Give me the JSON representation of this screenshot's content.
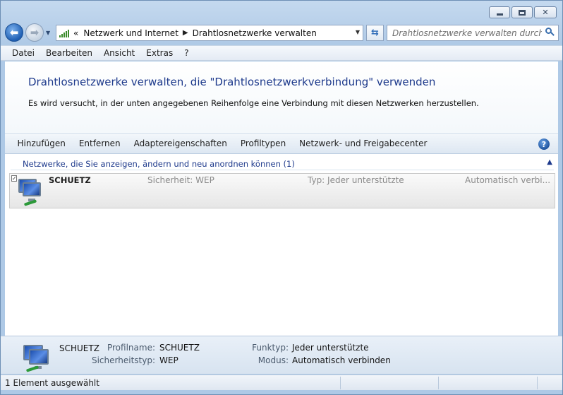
{
  "window": {
    "caption_buttons": [
      "minimize",
      "maximize",
      "close"
    ]
  },
  "nav": {
    "address_prefix": "«",
    "breadcrumbs": [
      "Netzwerk und Internet",
      "Drahtlosnetzwerke verwalten"
    ],
    "search_placeholder": "Drahtlosnetzwerke verwalten durchsu…"
  },
  "menu": [
    "Datei",
    "Bearbeiten",
    "Ansicht",
    "Extras",
    "?"
  ],
  "main": {
    "title": "Drahtlosnetzwerke verwalten, die \"Drahtlosnetzwerkverbindung\" verwenden",
    "description": "Es wird versucht, in der unten angegebenen Reihenfolge eine Verbindung mit diesen Netzwerken herzustellen."
  },
  "commands": [
    "Hinzufügen",
    "Entfernen",
    "Adaptereigenschaften",
    "Profiltypen",
    "Netzwerk- und Freigabecenter"
  ],
  "group": {
    "header": "Netzwerke, die Sie anzeigen, ändern und neu anordnen können (1)"
  },
  "networks": [
    {
      "name": "SCHUETZ",
      "security": "Sicherheit:  WEP",
      "type": "Typ:  Jeder unterstützte",
      "mode": "Automatisch verbi..."
    }
  ],
  "details": {
    "name": "SCHUETZ",
    "profile_label": "Profilname:",
    "profile_value": "SCHUETZ",
    "security_label": "Sicherheitstyp:",
    "security_value": "WEP",
    "func_label": "Funktyp:",
    "func_value": "Jeder unterstützte",
    "mode_label": "Modus:",
    "mode_value": "Automatisch verbinden"
  },
  "status": {
    "text": "1 Element ausgewählt"
  },
  "colors": {
    "title_blue": "#1e3a8c",
    "frame": "#b9d1ea"
  },
  "icons": [
    "back-arrow-icon",
    "forward-arrow-icon",
    "network-signal-icon",
    "refresh-icon",
    "search-icon",
    "help-icon",
    "wireless-network-icon"
  ]
}
